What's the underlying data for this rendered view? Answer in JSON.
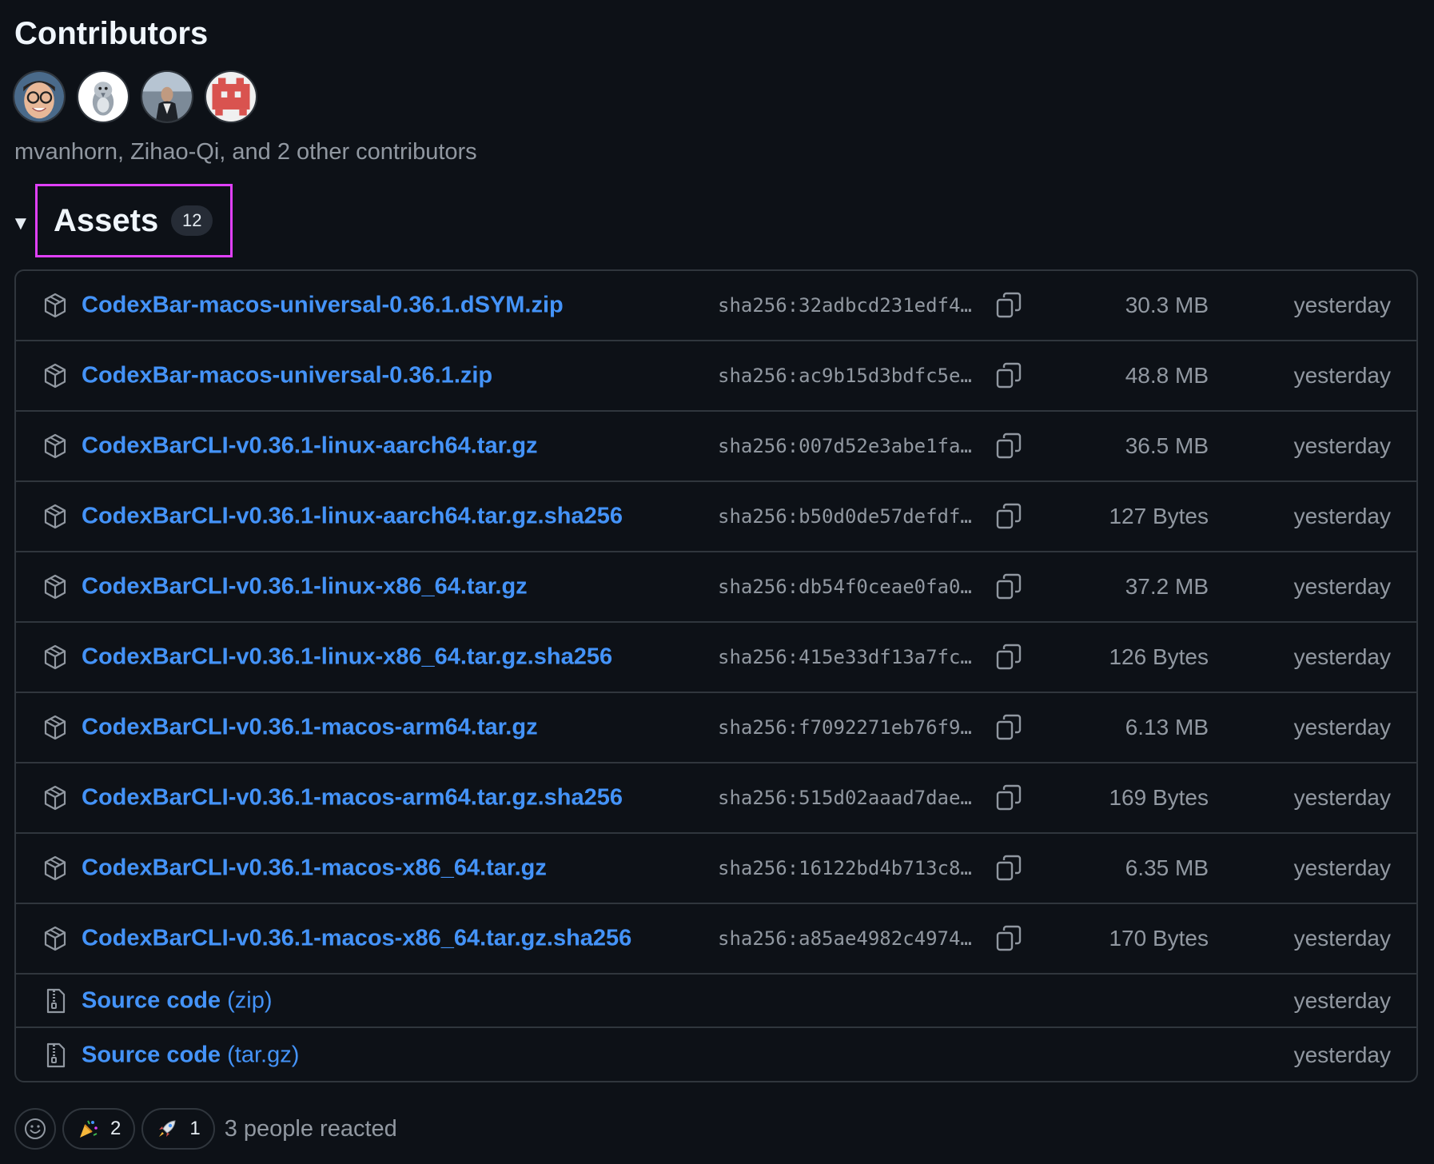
{
  "contributors": {
    "title": "Contributors",
    "summary": "mvanhorn, Zihao-Qi, and 2 other contributors",
    "avatars": [
      "mvanhorn",
      "Zihao-Qi",
      "contributor-3",
      "contributor-4"
    ]
  },
  "assets": {
    "title": "Assets",
    "count": "12",
    "toggle": "▼",
    "files": [
      {
        "name": "CodexBar-macos-universal-0.36.1.dSYM.zip",
        "sha": "sha256:32adbcd231edf4…",
        "size": "30.3 MB",
        "date": "yesterday"
      },
      {
        "name": "CodexBar-macos-universal-0.36.1.zip",
        "sha": "sha256:ac9b15d3bdfc5e…",
        "size": "48.8 MB",
        "date": "yesterday"
      },
      {
        "name": "CodexBarCLI-v0.36.1-linux-aarch64.tar.gz",
        "sha": "sha256:007d52e3abe1fa…",
        "size": "36.5 MB",
        "date": "yesterday"
      },
      {
        "name": "CodexBarCLI-v0.36.1-linux-aarch64.tar.gz.sha256",
        "sha": "sha256:b50d0de57defdf…",
        "size": "127 Bytes",
        "date": "yesterday"
      },
      {
        "name": "CodexBarCLI-v0.36.1-linux-x86_64.tar.gz",
        "sha": "sha256:db54f0ceae0fa0…",
        "size": "37.2 MB",
        "date": "yesterday"
      },
      {
        "name": "CodexBarCLI-v0.36.1-linux-x86_64.tar.gz.sha256",
        "sha": "sha256:415e33df13a7fc…",
        "size": "126 Bytes",
        "date": "yesterday"
      },
      {
        "name": "CodexBarCLI-v0.36.1-macos-arm64.tar.gz",
        "sha": "sha256:f7092271eb76f9…",
        "size": "6.13 MB",
        "date": "yesterday"
      },
      {
        "name": "CodexBarCLI-v0.36.1-macos-arm64.tar.gz.sha256",
        "sha": "sha256:515d02aaad7dae…",
        "size": "169 Bytes",
        "date": "yesterday"
      },
      {
        "name": "CodexBarCLI-v0.36.1-macos-x86_64.tar.gz",
        "sha": "sha256:16122bd4b713c8…",
        "size": "6.35 MB",
        "date": "yesterday"
      },
      {
        "name": "CodexBarCLI-v0.36.1-macos-x86_64.tar.gz.sha256",
        "sha": "sha256:a85ae4982c4974…",
        "size": "170 Bytes",
        "date": "yesterday"
      }
    ],
    "source": [
      {
        "name": "Source code",
        "suffix": "(zip)",
        "date": "yesterday"
      },
      {
        "name": "Source code",
        "suffix": "(tar.gz)",
        "date": "yesterday"
      }
    ]
  },
  "reactions": {
    "items": [
      {
        "icon": "party-popper-icon",
        "count": "2"
      },
      {
        "icon": "rocket-icon",
        "count": "1"
      }
    ],
    "summary": "3 people reacted"
  },
  "colors": {
    "background": "#0d1117",
    "link": "#4493f8",
    "muted": "#9198a1",
    "border": "#30363d",
    "highlight": "#e040fb"
  }
}
